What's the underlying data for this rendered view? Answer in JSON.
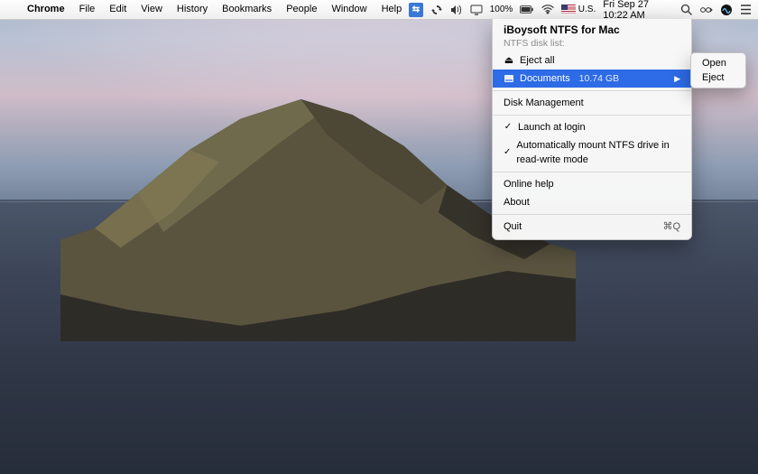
{
  "menubar": {
    "app": "Chrome",
    "items": [
      "File",
      "Edit",
      "View",
      "History",
      "Bookmarks",
      "People",
      "Window",
      "Help"
    ],
    "status": {
      "battery_pct": "100%",
      "battery_icon": "battery-full-charging-icon",
      "input_label": "U.S.",
      "clock": "Fri Sep 27  10:22 AM"
    }
  },
  "dropdown": {
    "title": "iBoysoft NTFS for Mac",
    "disk_list_label": "NTFS disk list:",
    "eject_all": "Eject all",
    "selected_disk": {
      "name": "Documents",
      "size": "10.74 GB"
    },
    "disk_management": "Disk Management",
    "launch_at_login": "Launch at login",
    "auto_mount": "Automatically mount NTFS drive in read-write mode",
    "online_help": "Online help",
    "about": "About",
    "quit": "Quit",
    "quit_shortcut": "⌘Q"
  },
  "submenu": {
    "open": "Open",
    "eject": "Eject"
  }
}
